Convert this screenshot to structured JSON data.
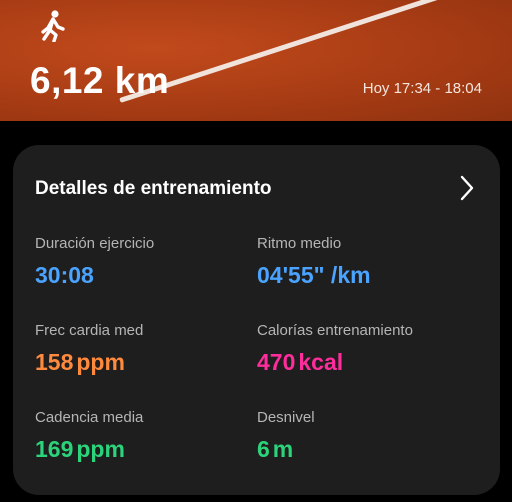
{
  "activity": {
    "icon": "runner-icon",
    "distance": "6,12 km",
    "time_range": "Hoy 17:34 - 18:04"
  },
  "details": {
    "title": "Detalles de entrenamiento",
    "metrics": [
      {
        "label": "Duración ejercicio",
        "value": "30:08",
        "unit": "",
        "color": "#4aa3ff"
      },
      {
        "label": "Ritmo medio",
        "value": "04'55\"",
        "unit": " /km",
        "color": "#4aa3ff"
      },
      {
        "label": "Frec cardia med",
        "value": "158",
        "unit": "ppm",
        "color": "#ff8a3d"
      },
      {
        "label": "Calorías entrenamiento",
        "value": "470",
        "unit": "kcal",
        "color": "#ff2d9b"
      },
      {
        "label": "Cadencia media",
        "value": "169",
        "unit": "ppm",
        "color": "#2bd47a"
      },
      {
        "label": "Desnivel",
        "value": "6",
        "unit": "m",
        "color": "#2bd47a"
      }
    ]
  }
}
